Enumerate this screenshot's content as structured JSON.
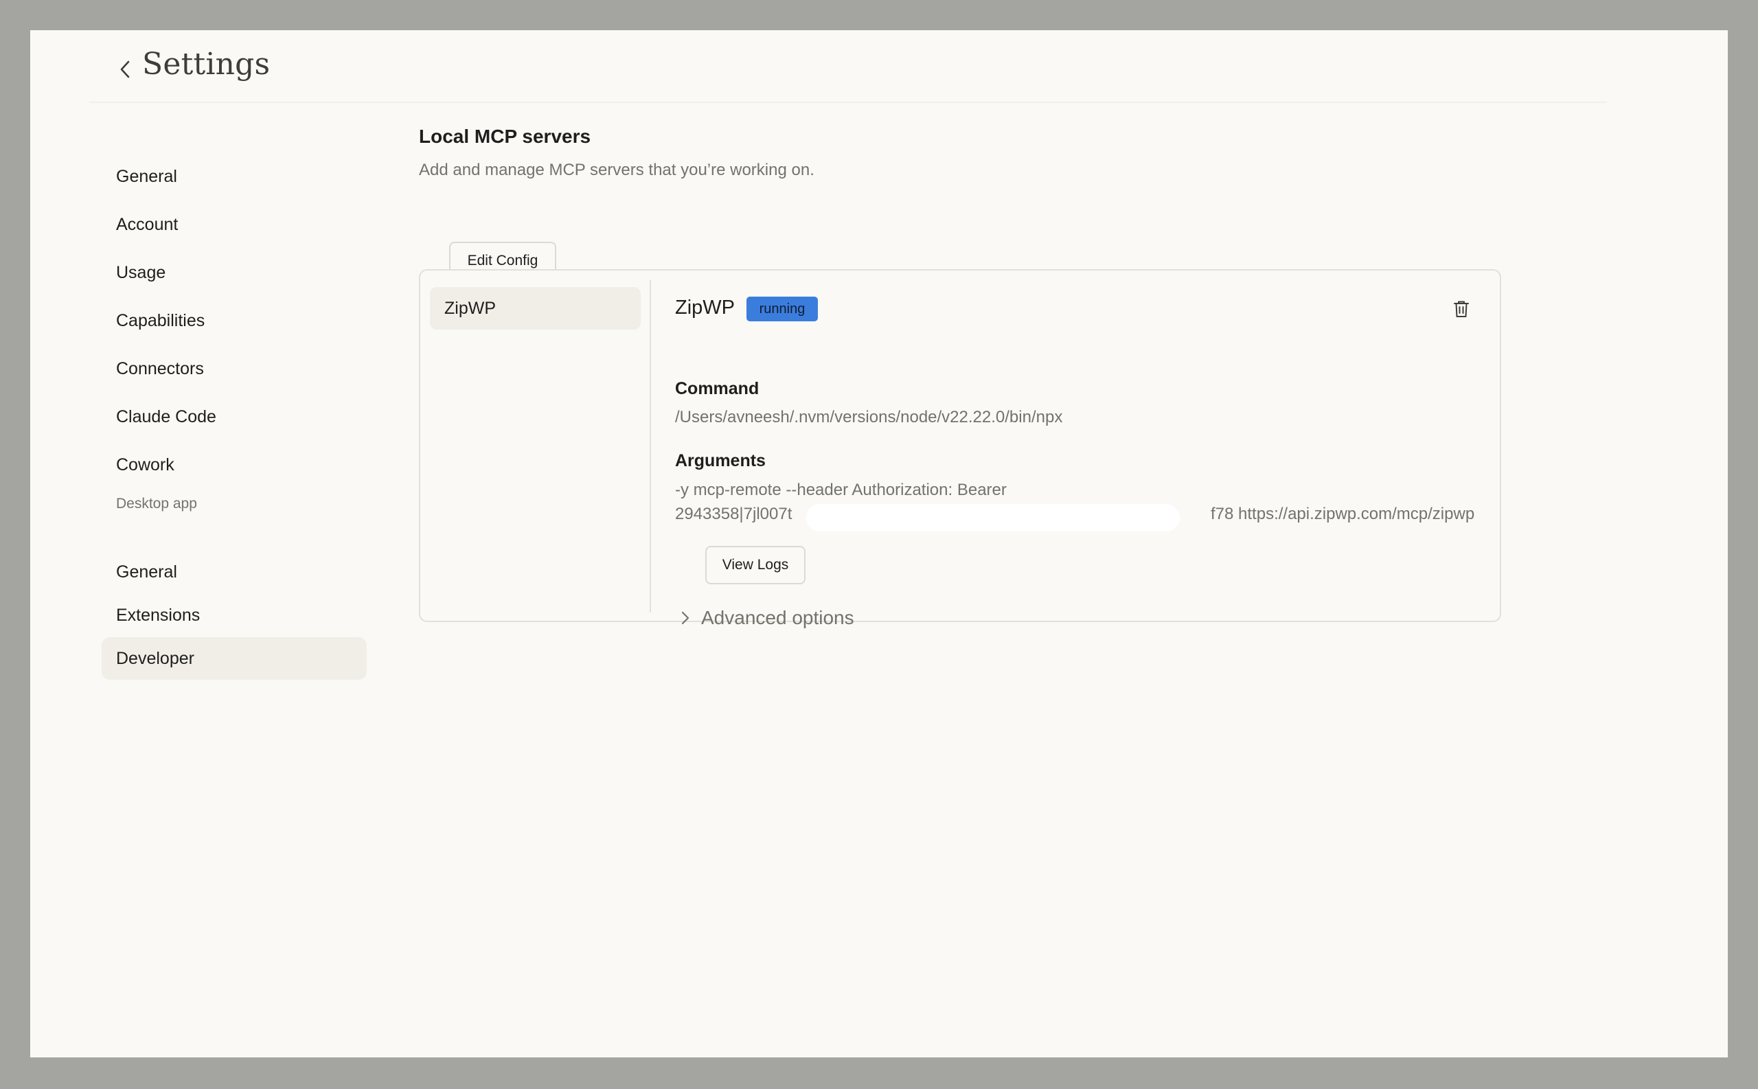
{
  "header": {
    "title": "Settings"
  },
  "sidebar": {
    "items": [
      {
        "label": "General"
      },
      {
        "label": "Account"
      },
      {
        "label": "Usage"
      },
      {
        "label": "Capabilities"
      },
      {
        "label": "Connectors"
      },
      {
        "label": "Claude Code"
      },
      {
        "label": "Cowork"
      }
    ],
    "desktop_section_label": "Desktop app",
    "desktop_items": [
      {
        "label": "General"
      },
      {
        "label": "Extensions"
      },
      {
        "label": "Developer",
        "active": true
      }
    ]
  },
  "main": {
    "heading": "Local MCP servers",
    "subtitle": "Add and manage MCP servers that you’re working on.",
    "edit_config_label": "Edit Config",
    "servers": [
      {
        "name": "ZipWP"
      }
    ],
    "detail": {
      "name": "ZipWP",
      "status": "running",
      "command_label": "Command",
      "command_value": "/Users/avneesh/.nvm/versions/node/v22.22.0/bin/npx",
      "arguments_label": "Arguments",
      "arguments_line1": "-y mcp-remote --header Authorization: Bearer",
      "arguments_line2_start": "2943358|7jl007t",
      "arguments_line2_end": "f78 https://api.zipwp.com/mcp/zipwp",
      "view_logs_label": "View Logs",
      "advanced_label": "Advanced options"
    }
  },
  "colors": {
    "background": "#faf9f5",
    "frame": "#a4a4a1",
    "status_badge": "#3b7ddd",
    "active_item": "#f0eee7",
    "muted_text": "#73726c"
  },
  "icons": {
    "back": "chevron-left-icon",
    "delete": "trash-icon",
    "advanced": "chevron-right-icon"
  }
}
